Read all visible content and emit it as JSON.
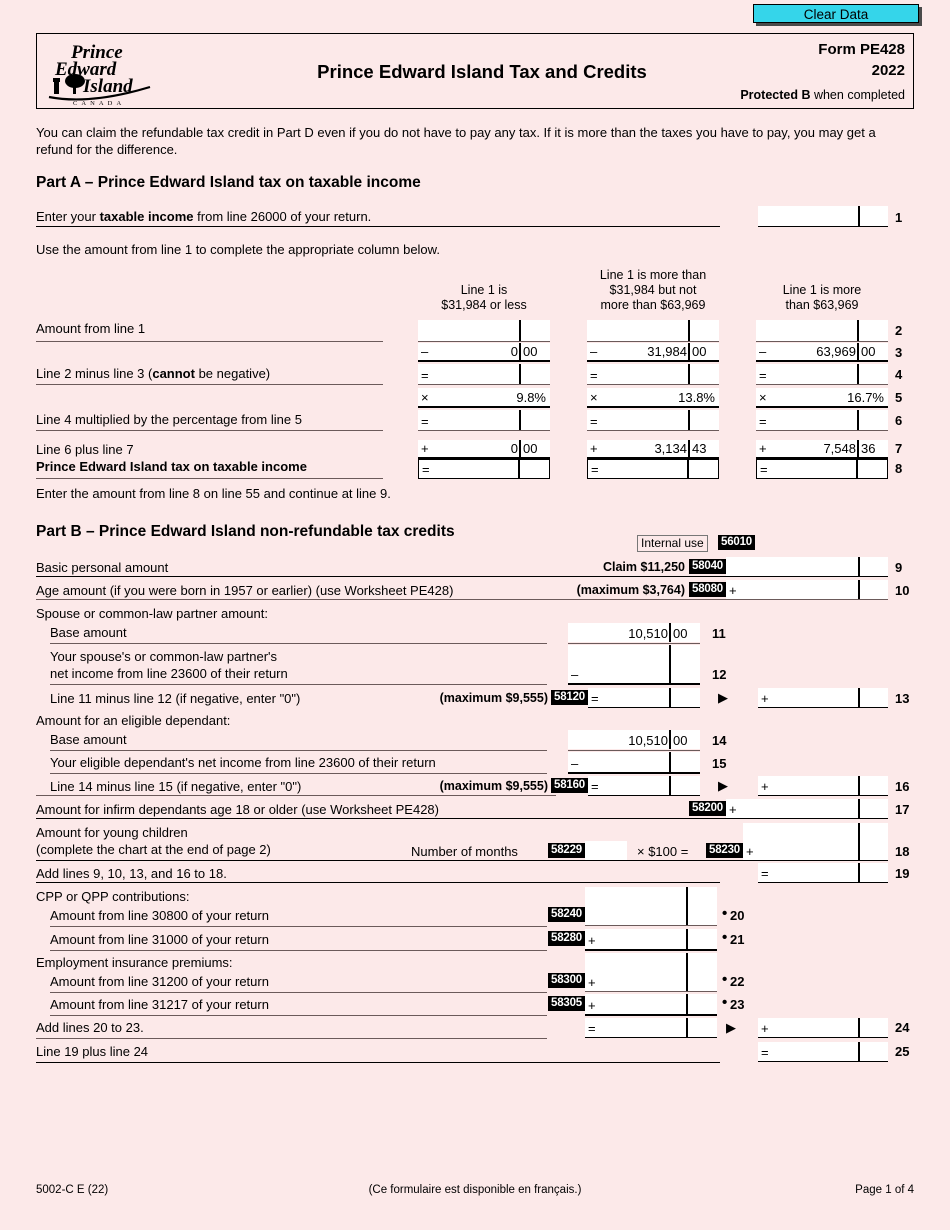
{
  "toolbar": {
    "clear_data_label": "Clear Data"
  },
  "header": {
    "logo_lines": [
      "Prince",
      "Edward",
      "Island"
    ],
    "logo_country": "C A N A D A",
    "title": "Prince Edward Island Tax and Credits",
    "form_number": "Form PE428",
    "year": "2022",
    "protected_bold": "Protected B",
    "protected_rest": " when completed"
  },
  "intro": "You can claim the refundable tax credit in Part D even if you do not have to pay any tax. If it is more than the taxes you have to pay, you may get a refund for the difference.",
  "part_a": {
    "heading": "Part A – Prince Edward Island tax on taxable income",
    "line1_label_pre": "Enter your ",
    "line1_label_bold": "taxable income",
    "line1_label_post": " from line 26000 of your return.",
    "line1_number": "1",
    "instruction": "Use the amount from line 1 to complete the appropriate column below.",
    "columns": [
      {
        "head_l1": "Line 1 is",
        "head_l2": "$31,984 or less",
        "head_l3": ""
      },
      {
        "head_l1": "Line 1 is more than",
        "head_l2": "$31,984 but not",
        "head_l3": "more than $63,969"
      },
      {
        "head_l1": "Line 1 is more",
        "head_l2": "than $63,969",
        "head_l3": ""
      }
    ],
    "rows": [
      {
        "num": "2",
        "label": "Amount from line 1",
        "label_bold": "",
        "label_post": "",
        "ops": [
          "",
          "",
          ""
        ],
        "values": [
          "",
          "",
          ""
        ],
        "cents": [
          "",
          "",
          ""
        ]
      },
      {
        "num": "3",
        "label": "",
        "label_bold": "",
        "label_post": "",
        "ops": [
          "–",
          "–",
          "–"
        ],
        "values": [
          "0",
          "31,984",
          "63,969"
        ],
        "cents": [
          "00",
          "00",
          "00"
        ]
      },
      {
        "num": "4",
        "label": "Line 2 minus line 3 (",
        "label_bold": "cannot",
        "label_post": " be negative)",
        "ops": [
          "=",
          "=",
          "="
        ],
        "values": [
          "",
          "",
          ""
        ],
        "cents": [
          "",
          "",
          ""
        ]
      },
      {
        "num": "5",
        "label": "",
        "label_bold": "",
        "label_post": "",
        "ops": [
          "×",
          "×",
          "×"
        ],
        "values": [
          "9.8%",
          "13.8%",
          "16.7%"
        ],
        "cents": [
          "",
          "",
          ""
        ]
      },
      {
        "num": "6",
        "label": "Line 4 multiplied by the percentage from line 5",
        "label_bold": "",
        "label_post": "",
        "ops": [
          "=",
          "=",
          "="
        ],
        "values": [
          "",
          "",
          ""
        ],
        "cents": [
          "",
          "",
          ""
        ]
      },
      {
        "num": "7",
        "label": "Line 6 plus line 7",
        "label_bold": "",
        "label_post": "",
        "ops": [
          "+",
          "+",
          "+"
        ],
        "values": [
          "0",
          "3,134",
          "7,548"
        ],
        "cents": [
          "00",
          "43",
          "36"
        ]
      },
      {
        "num": "8",
        "label": "",
        "label_bold": "Prince Edward Island tax on taxable income",
        "label_post": "",
        "ops": [
          "=",
          "=",
          "="
        ],
        "values": [
          "",
          "",
          ""
        ],
        "cents": [
          "",
          "",
          ""
        ]
      }
    ],
    "closing": "Enter the amount from line 8 on line 55 and continue at line 9."
  },
  "part_b": {
    "heading": "Part B – Prince Edward Island non-refundable tax credits",
    "internal_use_label": "Internal use",
    "internal_use_code": "56010",
    "line9": {
      "label": "Basic personal amount",
      "claim": "Claim $11,250",
      "code": "58040",
      "op": "",
      "num": "9"
    },
    "line10": {
      "label": "Age amount (if you were born in 1957 or earlier) (use Worksheet PE428)",
      "claim": "(maximum $3,764)",
      "code": "58080",
      "op": "+",
      "num": "10"
    },
    "spouse_header": "Spouse or common-law partner amount:",
    "line11": {
      "label": "Base amount",
      "value": "10,510",
      "cents": "00",
      "num": "11"
    },
    "line12": {
      "label_l1": "Your spouse's or common-law partner's",
      "label_l2": "net income from line 23600 of their return",
      "op": "–",
      "num": "12"
    },
    "line13": {
      "label": "Line 11 minus line 12 (if negative, enter \"0\")",
      "claim": "(maximum $9,555)",
      "code": "58120",
      "op": "=",
      "right_op": "+",
      "num": "13"
    },
    "dependant_header": "Amount for an eligible dependant:",
    "line14": {
      "label": "Base amount",
      "value": "10,510",
      "cents": "00",
      "num": "14"
    },
    "line15": {
      "label": "Your eligible dependant's net income from line 23600 of their return",
      "op": "–",
      "num": "15"
    },
    "line16": {
      "label": "Line 14 minus line 15 (if negative, enter \"0\")",
      "claim": "(maximum $9,555)",
      "code": "58160",
      "op": "=",
      "right_op": "+",
      "num": "16"
    },
    "line17": {
      "label": "Amount for infirm dependants age 18 or older (use Worksheet PE428)",
      "code": "58200",
      "op": "+",
      "num": "17"
    },
    "line18": {
      "label_l1": "Amount for young children",
      "label_l2": "(complete the chart at the end of page 2)",
      "months_label": "Number of months",
      "months_code": "58229",
      "multiplier": "× $100  =",
      "code": "58230",
      "op": "+",
      "num": "18"
    },
    "line19": {
      "label": "Add lines 9, 10, 13, and 16 to 18.",
      "op": "=",
      "num": "19"
    },
    "cpp_header": "CPP or QPP contributions:",
    "line20": {
      "label": "Amount from line 30800 of your return",
      "code": "58240",
      "op": "",
      "num": "20"
    },
    "line21": {
      "label": "Amount from line 31000 of your return",
      "code": "58280",
      "op": "+",
      "num": "21"
    },
    "ei_header": "Employment insurance premiums:",
    "line22": {
      "label": "Amount from line 31200 of your return",
      "code": "58300",
      "op": "+",
      "num": "22"
    },
    "line23": {
      "label": "Amount from line 31217 of your return",
      "code": "58305",
      "op": "+",
      "num": "23"
    },
    "line24": {
      "label": "Add lines 20 to 23.",
      "op": "=",
      "right_op": "+",
      "num": "24"
    },
    "line25": {
      "label": "Line 19 plus line 24",
      "op": "=",
      "num": "25"
    }
  },
  "footer": {
    "left": "5002-C E (22)",
    "middle": "(Ce formulaire est disponible en français.)",
    "right": "Page 1 of 4"
  }
}
